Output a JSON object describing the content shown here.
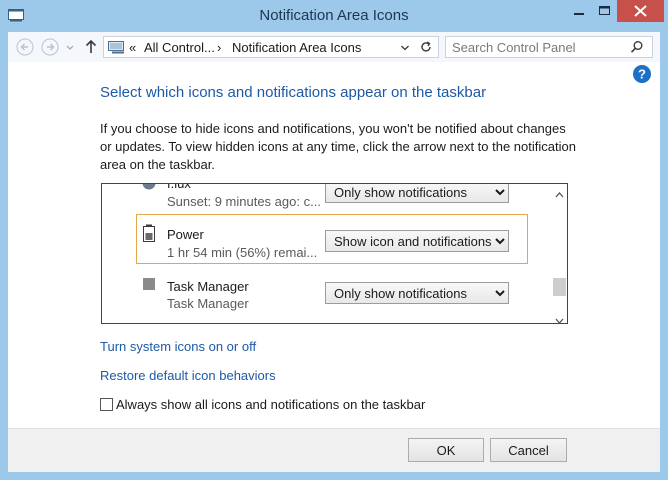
{
  "window": {
    "title": "Notification Area Icons"
  },
  "address_bar": {
    "crumb_root": "All Control...",
    "crumb_current": "Notification Area Icons",
    "search_placeholder": "Search Control Panel"
  },
  "main": {
    "heading": "Select which icons and notifications appear on the taskbar",
    "description": "If you choose to hide icons and notifications, you won't be notified about changes or updates. To view hidden icons at any time, click the arrow next to the notification area on the taskbar.",
    "icons": [
      {
        "name": "f.lux",
        "subtitle": "Sunset: 9 minutes ago: c...",
        "behavior": "Only show notifications"
      },
      {
        "name": "Power",
        "subtitle": "1 hr 54 min (56%) remai...",
        "behavior": "Show icon and notifications"
      },
      {
        "name": "Task Manager",
        "subtitle": "Task Manager",
        "behavior": "Only show notifications"
      }
    ],
    "links": {
      "system_icons": "Turn system icons on or off",
      "restore_defaults": "Restore default icon behaviors"
    },
    "always_show_label": "Always show all icons and notifications on the taskbar",
    "always_show_checked": false
  },
  "footer": {
    "ok_label": "OK",
    "cancel_label": "Cancel"
  },
  "colors": {
    "frame": "#9cc8ea",
    "close_button": "#c7504a",
    "link": "#1d5aa6",
    "focus_border": "#e5a54a"
  }
}
